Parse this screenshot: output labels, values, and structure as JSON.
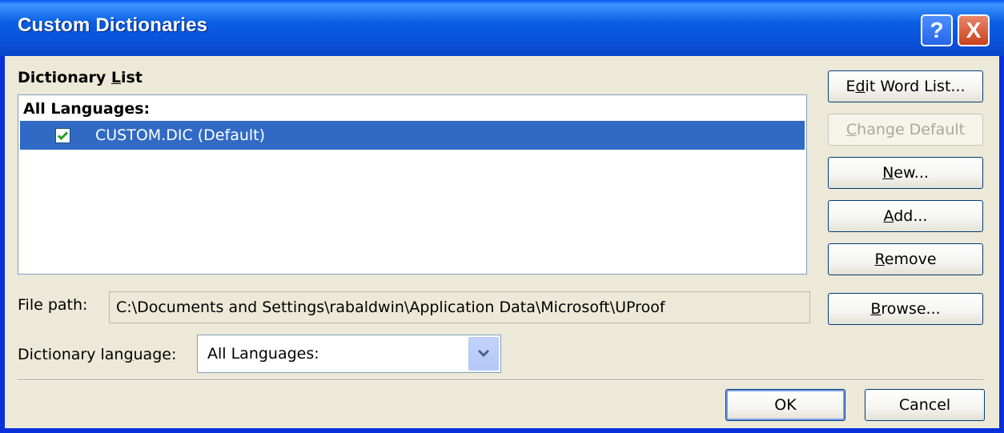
{
  "window": {
    "title": "Custom Dictionaries"
  },
  "titlebar": {
    "help_label": "?",
    "close_label": "X"
  },
  "dictionary_list": {
    "label_prefix": "Dictionary ",
    "label_mnemonic": "L",
    "label_suffix": "ist",
    "group_header": "All Languages:",
    "items": [
      {
        "label": "CUSTOM.DIC (Default)",
        "checked": true,
        "selected": true
      }
    ]
  },
  "buttons": {
    "edit_word_list": {
      "pre": "E",
      "key": "d",
      "post": "it Word List..."
    },
    "change_default": {
      "pre": "",
      "key": "C",
      "post": "hange Default",
      "disabled": true
    },
    "new": {
      "pre": "",
      "key": "N",
      "post": "ew..."
    },
    "add": {
      "pre": "",
      "key": "A",
      "post": "dd..."
    },
    "remove": {
      "pre": "",
      "key": "R",
      "post": "emove"
    },
    "browse": {
      "pre": "",
      "key": "B",
      "post": "rowse..."
    },
    "ok": "OK",
    "cancel": "Cancel"
  },
  "file_path": {
    "label": "File path:",
    "value": "C:\\Documents and Settings\\rabaldwin\\Application Data\\Microsoft\\UProof"
  },
  "dictionary_language": {
    "label_pre": "Dictionary lan",
    "label_key": "g",
    "label_post": "uage:",
    "value": "All Languages:"
  },
  "colors": {
    "selection": "#316ac5",
    "titlebar": "#0a5fe3",
    "dialog_bg": "#ece9d8"
  }
}
